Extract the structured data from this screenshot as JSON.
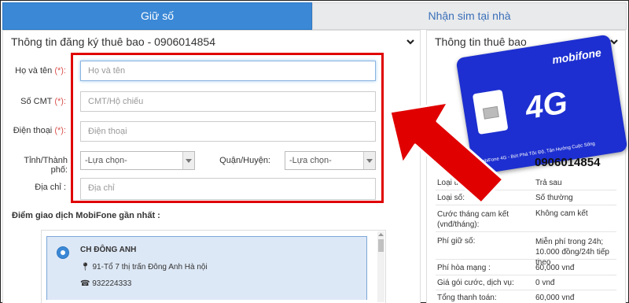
{
  "tabs": [
    {
      "label": "Giữ số",
      "active": true
    },
    {
      "label": "Nhận sim tại nhà",
      "active": false
    }
  ],
  "left_panel": {
    "title": "Thông tin đăng ký thuê bao - 0906014854",
    "form": {
      "name_label": "Họ và tên",
      "name_placeholder": "Họ và tên",
      "id_label": "Số CMT",
      "id_placeholder": "CMT/Hộ chiếu",
      "phone_label": "Điện thoại",
      "phone_placeholder": "Điện thoại",
      "required_mark": "(*):",
      "province_label": "Tỉnh/Thành phố:",
      "province_value": "-Lựa chọn-",
      "district_label": "Quận/Huyện:",
      "district_value": "-Lựa chọn-",
      "address_label": "Địa chỉ",
      "address_colon": ":",
      "address_placeholder": "Địa chỉ"
    },
    "nearest_title": "Điểm giao dịch MobiFone gần nhất :",
    "store": {
      "name": "CH ĐÔNG ANH",
      "address": "91-Tổ 7 thị trấn Đông Anh Hà nội",
      "phone": "932224333"
    }
  },
  "right_panel": {
    "title": "Thông tin thuê bao",
    "sim_card": {
      "brand": "mobifone",
      "network": "4G",
      "tagline": "MobiFone 4G - Bứt Phá Tốc Độ, Tận Hưởng Cuộc Sống"
    },
    "number": "0906014854",
    "rows": [
      {
        "label": "Loại thuê bao:",
        "value": "Trả sau"
      },
      {
        "label": "Loại số:",
        "value": "Số thường"
      },
      {
        "label": "Cước tháng cam kết (vnđ/tháng):",
        "value": "Không cam kết"
      },
      {
        "label": "Phí giữ số:",
        "value": "Miễn phí trong 24h; 10.000 đồng/24h tiếp theo"
      },
      {
        "label": "Phí hòa mạng :",
        "value": "60,000 vnđ"
      },
      {
        "label": "Giá gói cước, dịch vụ:",
        "value": "0 vnđ"
      },
      {
        "label": "Tổng thanh toán:",
        "value": "60,000 vnđ"
      }
    ]
  },
  "colors": {
    "tab_active": "#3a88d6",
    "highlight": "#e00000",
    "sim_blue": "#1d2fd0"
  }
}
